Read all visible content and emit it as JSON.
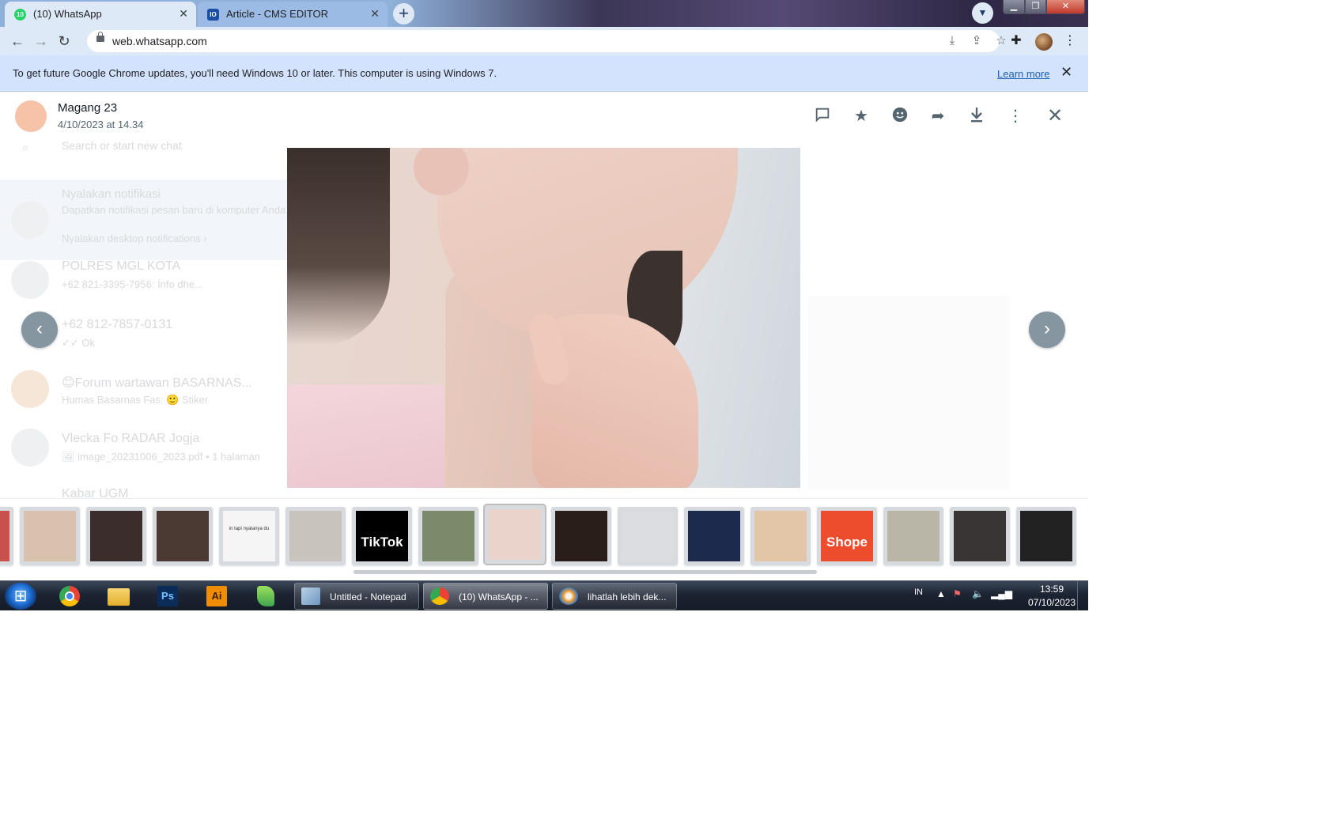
{
  "browser": {
    "tabs": [
      {
        "title": "(10) WhatsApp",
        "favicon": "whatsapp-icon",
        "active": true
      },
      {
        "title": "Article - CMS EDITOR",
        "favicon": "cms-icon",
        "active": false
      }
    ],
    "close_symbol": "✕",
    "new_tab_symbol": "+",
    "url": "web.whatsapp.com"
  },
  "infobar": {
    "message": "To get future Google Chrome updates, you'll need Windows 10 or later. This computer is using Windows 7.",
    "link": "Learn more",
    "close_symbol": "✕"
  },
  "viewer": {
    "sender_name": "Magang 23",
    "timestamp": "4/10/2023 at 14.34",
    "actions": [
      "reply-icon",
      "star-icon",
      "emoji-icon",
      "forward-icon",
      "download-icon",
      "menu-icon",
      "close-icon"
    ],
    "thumbnails": [
      {
        "name": "thumb-1",
        "color": "#c9514b"
      },
      {
        "name": "thumb-2",
        "color": "#d9c2ad"
      },
      {
        "name": "thumb-3",
        "color": "#3a2d2c"
      },
      {
        "name": "thumb-4",
        "color": "#4a3a33"
      },
      {
        "name": "thumb-5",
        "color": "#f5f5f5",
        "text": "in tapi nyatanya du"
      },
      {
        "name": "thumb-6",
        "color": "#c8c4bd"
      },
      {
        "name": "thumb-7",
        "color": "#000000",
        "text": "TikTok"
      },
      {
        "name": "thumb-8",
        "color": "#7c8a6c"
      },
      {
        "name": "thumb-9",
        "color": "#e9d3cb",
        "active": true
      },
      {
        "name": "thumb-10",
        "color": "#2a1e1a"
      },
      {
        "name": "thumb-11",
        "color": "#dcdde1"
      },
      {
        "name": "thumb-12",
        "color": "#1b2a4d"
      },
      {
        "name": "thumb-13",
        "color": "#e3c6a8"
      },
      {
        "name": "thumb-14",
        "color": "#ee4d2d",
        "text": "Shope"
      },
      {
        "name": "thumb-15",
        "color": "#b9b6a8"
      },
      {
        "name": "thumb-16",
        "color": "#3a3535"
      },
      {
        "name": "thumb-17",
        "color": "#222222"
      }
    ]
  },
  "background_chats": [
    {
      "name": "Nyalakan notifikasi",
      "preview": "Dapatkan notifikasi pesan baru di komputer Anda",
      "extra": "Nyalakan desktop notifications ›"
    },
    {
      "name": "POLRES MGL KOTA",
      "preview": "+62 821-3395-7956: Info dhe...",
      "time": ""
    },
    {
      "name": "+62 812-7857-0131",
      "preview": "✓✓ Ok"
    },
    {
      "name": "😊Forum wartawan BASARNAS...",
      "preview": "Humas Basarnas Fas: 🙂 Stiker"
    },
    {
      "name": "Vlecka Fo RADAR Jogja",
      "preview": "🖼 image_20231006_2023.pdf • 1 halaman"
    },
    {
      "name": "Kabar UGM",
      "preview": ""
    }
  ],
  "background_search_placeholder": "Search or start new chat",
  "taskbar": {
    "pinned": [
      {
        "name": "chrome-icon",
        "label": ""
      },
      {
        "name": "file-explorer-icon",
        "label": ""
      },
      {
        "name": "photoshop-icon",
        "label": "Ps"
      },
      {
        "name": "illustrator-icon",
        "label": "Ai"
      },
      {
        "name": "green-app-icon",
        "label": ""
      }
    ],
    "tasks": [
      {
        "label": "Untitled - Notepad",
        "icon": "notepad-icon"
      },
      {
        "label": "(10) WhatsApp - ...",
        "icon": "chrome-icon"
      },
      {
        "label": "lihatlah lebih dek...",
        "icon": "paint-icon"
      }
    ],
    "language": "IN",
    "time": "13:59",
    "date": "07/10/2023"
  }
}
